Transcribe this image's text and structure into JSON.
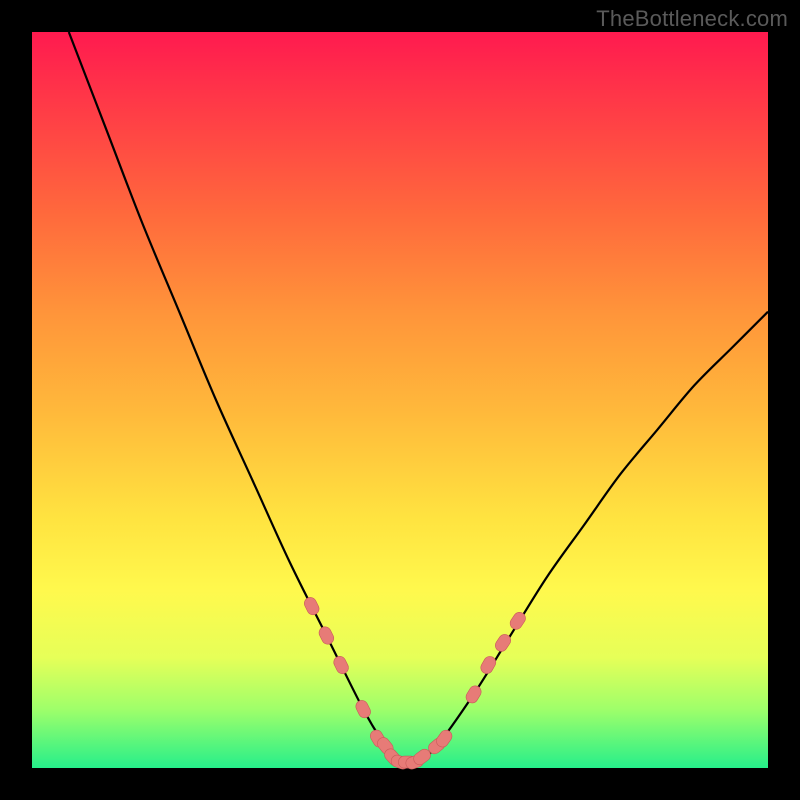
{
  "watermark": "TheBottleneck.com",
  "colors": {
    "frame": "#000000",
    "gradient_top": "#ff1a4f",
    "gradient_mid1": "#ff943a",
    "gradient_mid2": "#ffe340",
    "gradient_bottom": "#26ef8a",
    "curve": "#000000",
    "marker_fill": "#e77b77",
    "marker_stroke": "#c95a59"
  },
  "chart_data": {
    "type": "line",
    "title": "",
    "xlabel": "",
    "ylabel": "",
    "xlim": [
      0,
      100
    ],
    "ylim": [
      0,
      100
    ],
    "series": [
      {
        "name": "bottleneck-curve",
        "x": [
          5,
          10,
          15,
          20,
          25,
          30,
          35,
          40,
          45,
          48,
          50,
          52,
          55,
          60,
          65,
          70,
          75,
          80,
          85,
          90,
          95,
          100
        ],
        "y": [
          100,
          87,
          74,
          62,
          50,
          39,
          28,
          18,
          8,
          3,
          0.5,
          0.5,
          3,
          10,
          18,
          26,
          33,
          40,
          46,
          52,
          57,
          62
        ]
      }
    ],
    "markers": {
      "name": "highlighted-points",
      "x": [
        38,
        40,
        42,
        45,
        47,
        48,
        49,
        50,
        51,
        52,
        53,
        55,
        56,
        60,
        62,
        64,
        66
      ],
      "y": [
        22,
        18,
        14,
        8,
        4,
        3,
        1.5,
        0.8,
        0.8,
        0.8,
        1.5,
        3,
        4,
        10,
        14,
        17,
        20
      ]
    }
  }
}
